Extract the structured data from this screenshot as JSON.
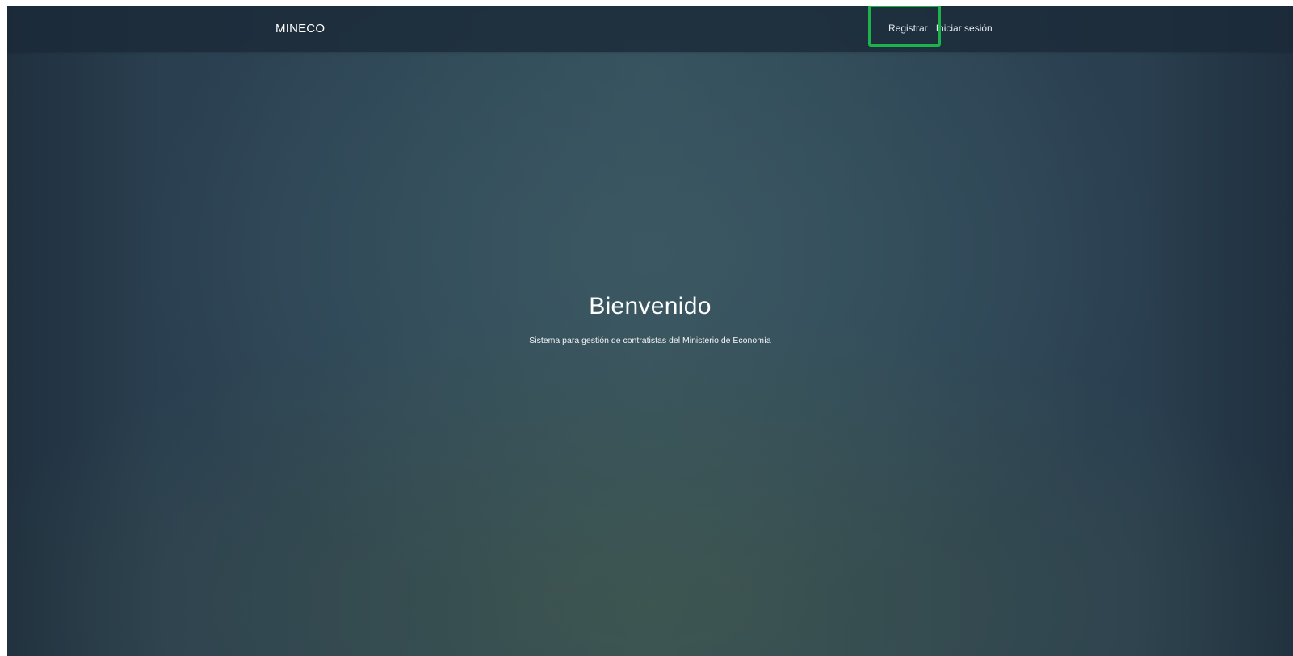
{
  "navbar": {
    "brand": "MINECO",
    "links": {
      "register": "Registrar",
      "login": "Iniciar sesión"
    }
  },
  "hero": {
    "title": "Bienvenido",
    "subtitle": "Sistema para gestión de contratistas del Ministerio de Economía"
  },
  "colors": {
    "highlight": "#1db34a",
    "navbar": "#1b2938"
  }
}
